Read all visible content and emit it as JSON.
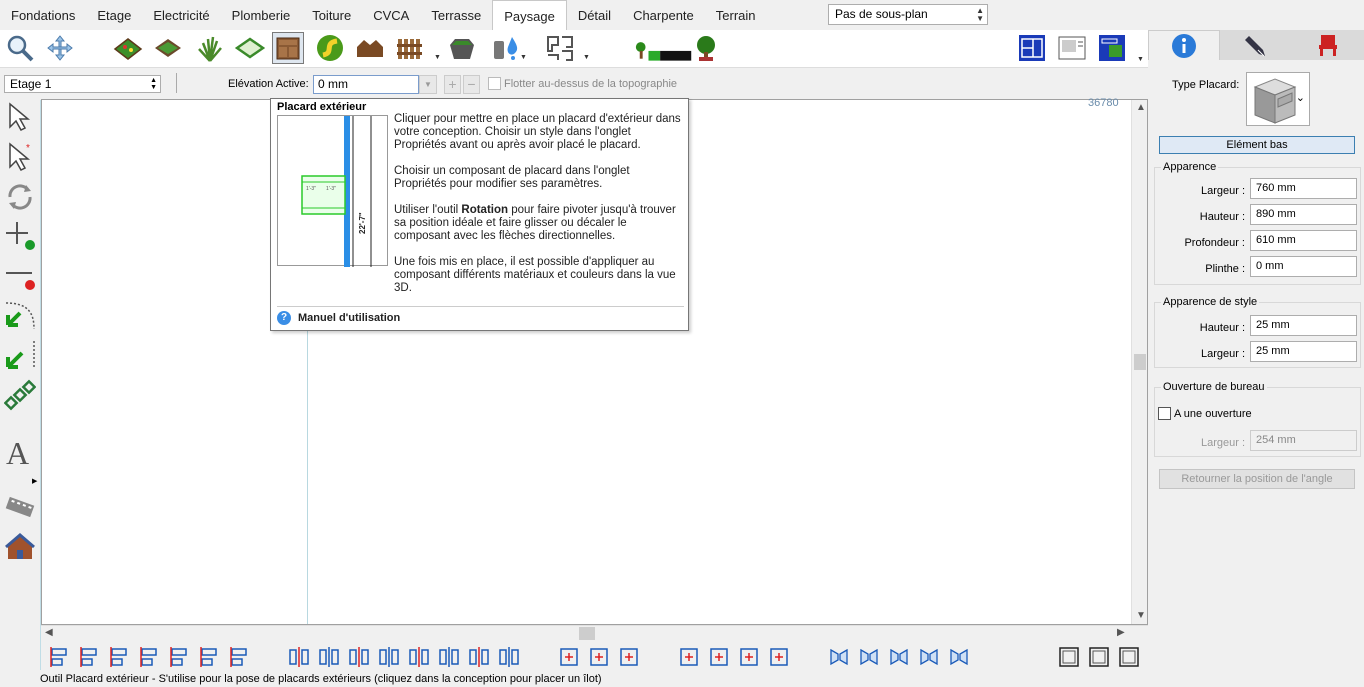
{
  "tabs": [
    {
      "label": "Fondations"
    },
    {
      "label": "Etage"
    },
    {
      "label": "Electricité"
    },
    {
      "label": "Plomberie"
    },
    {
      "label": "Toiture"
    },
    {
      "label": "CVCA"
    },
    {
      "label": "Terrasse"
    },
    {
      "label": "Paysage",
      "active": true
    },
    {
      "label": "Détail"
    },
    {
      "label": "Charpente"
    },
    {
      "label": "Terrain"
    }
  ],
  "subplan": {
    "value": "Pas de sous-plan"
  },
  "levelbar": {
    "level": "Etage 1",
    "elevation_label": "Elévation Active:",
    "elevation_value": "0 mm",
    "float_label": "Flotter au-dessus de la topographie"
  },
  "canvas": {
    "coord": "36780"
  },
  "tooltip": {
    "title": "Placard extérieur",
    "para1": "Cliquer pour mettre en place un placard d'extérieur dans votre conception. Choisir un style dans l'onglet Propriétés avant ou après avoir placé le placard.",
    "para2": "Choisir un composant de placard dans l'onglet Propriétés pour modifier ses paramètres.",
    "para3_pre": "Utiliser l'outil ",
    "para3_bold": "Rotation",
    "para3_post": " pour faire pivoter jusqu'à trouver sa position idéale et faire glisser ou décaler le composant avec les flèches directionnelles.",
    "para4": "Une fois mis en place, il est possible d'appliquer au composant différents matériaux et couleurs dans la vue 3D.",
    "manual": "Manuel d'utilisation",
    "dim_label": "22'-7\"",
    "dim_small1": "1'-3\"",
    "dim_small2": "1'-3\""
  },
  "status": "Outil Placard extérieur - S'utilise pour la pose de placards extérieurs (cliquez dans la conception pour placer un îlot)",
  "panel": {
    "type_label": "Type Placard:",
    "element_button": "Elément bas",
    "appearance": {
      "title": "Apparence",
      "fields": [
        {
          "label": "Largeur :",
          "value": "760 mm"
        },
        {
          "label": "Hauteur :",
          "value": "890 mm"
        },
        {
          "label": "Profondeur :",
          "value": "610 mm"
        },
        {
          "label": "Plinthe :",
          "value": "0 mm"
        }
      ]
    },
    "style": {
      "title": "Apparence de style",
      "fields": [
        {
          "label": "Hauteur :",
          "value": "25 mm"
        },
        {
          "label": "Largeur :",
          "value": "25 mm"
        }
      ]
    },
    "opening": {
      "title": "Ouverture de bureau",
      "checkbox_label": "A une ouverture",
      "width_label": "Largeur :",
      "width_value": "254 mm"
    },
    "reset_button": "Retourner la position de l'angle"
  },
  "icons": {
    "toolbar": [
      "zoom-icon",
      "pan-icon",
      "garden-bed-icon",
      "raised-bed-icon",
      "grass-icon",
      "border-bed-icon",
      "outdoor-cabinet-icon",
      "path-icon",
      "shed-icon",
      "fence-icon",
      "planter-icon",
      "water-feature-icon",
      "paver-pattern-icon",
      "plant-height-icon",
      "tree-icon",
      "plan-view-icon",
      "layout-view-icon",
      "site-plan-icon"
    ],
    "left": [
      "select-arrow-icon",
      "multi-select-icon",
      "rotate-icon",
      "add-point-icon",
      "remove-point-icon",
      "arc-icon",
      "arc-break-icon",
      "chain-icon",
      "text-icon",
      "film-icon",
      "house-icon"
    ]
  },
  "colors": {
    "accent": "#3c7fb1",
    "help": "#3a8ee6",
    "selected_tab": "#ffffff"
  }
}
